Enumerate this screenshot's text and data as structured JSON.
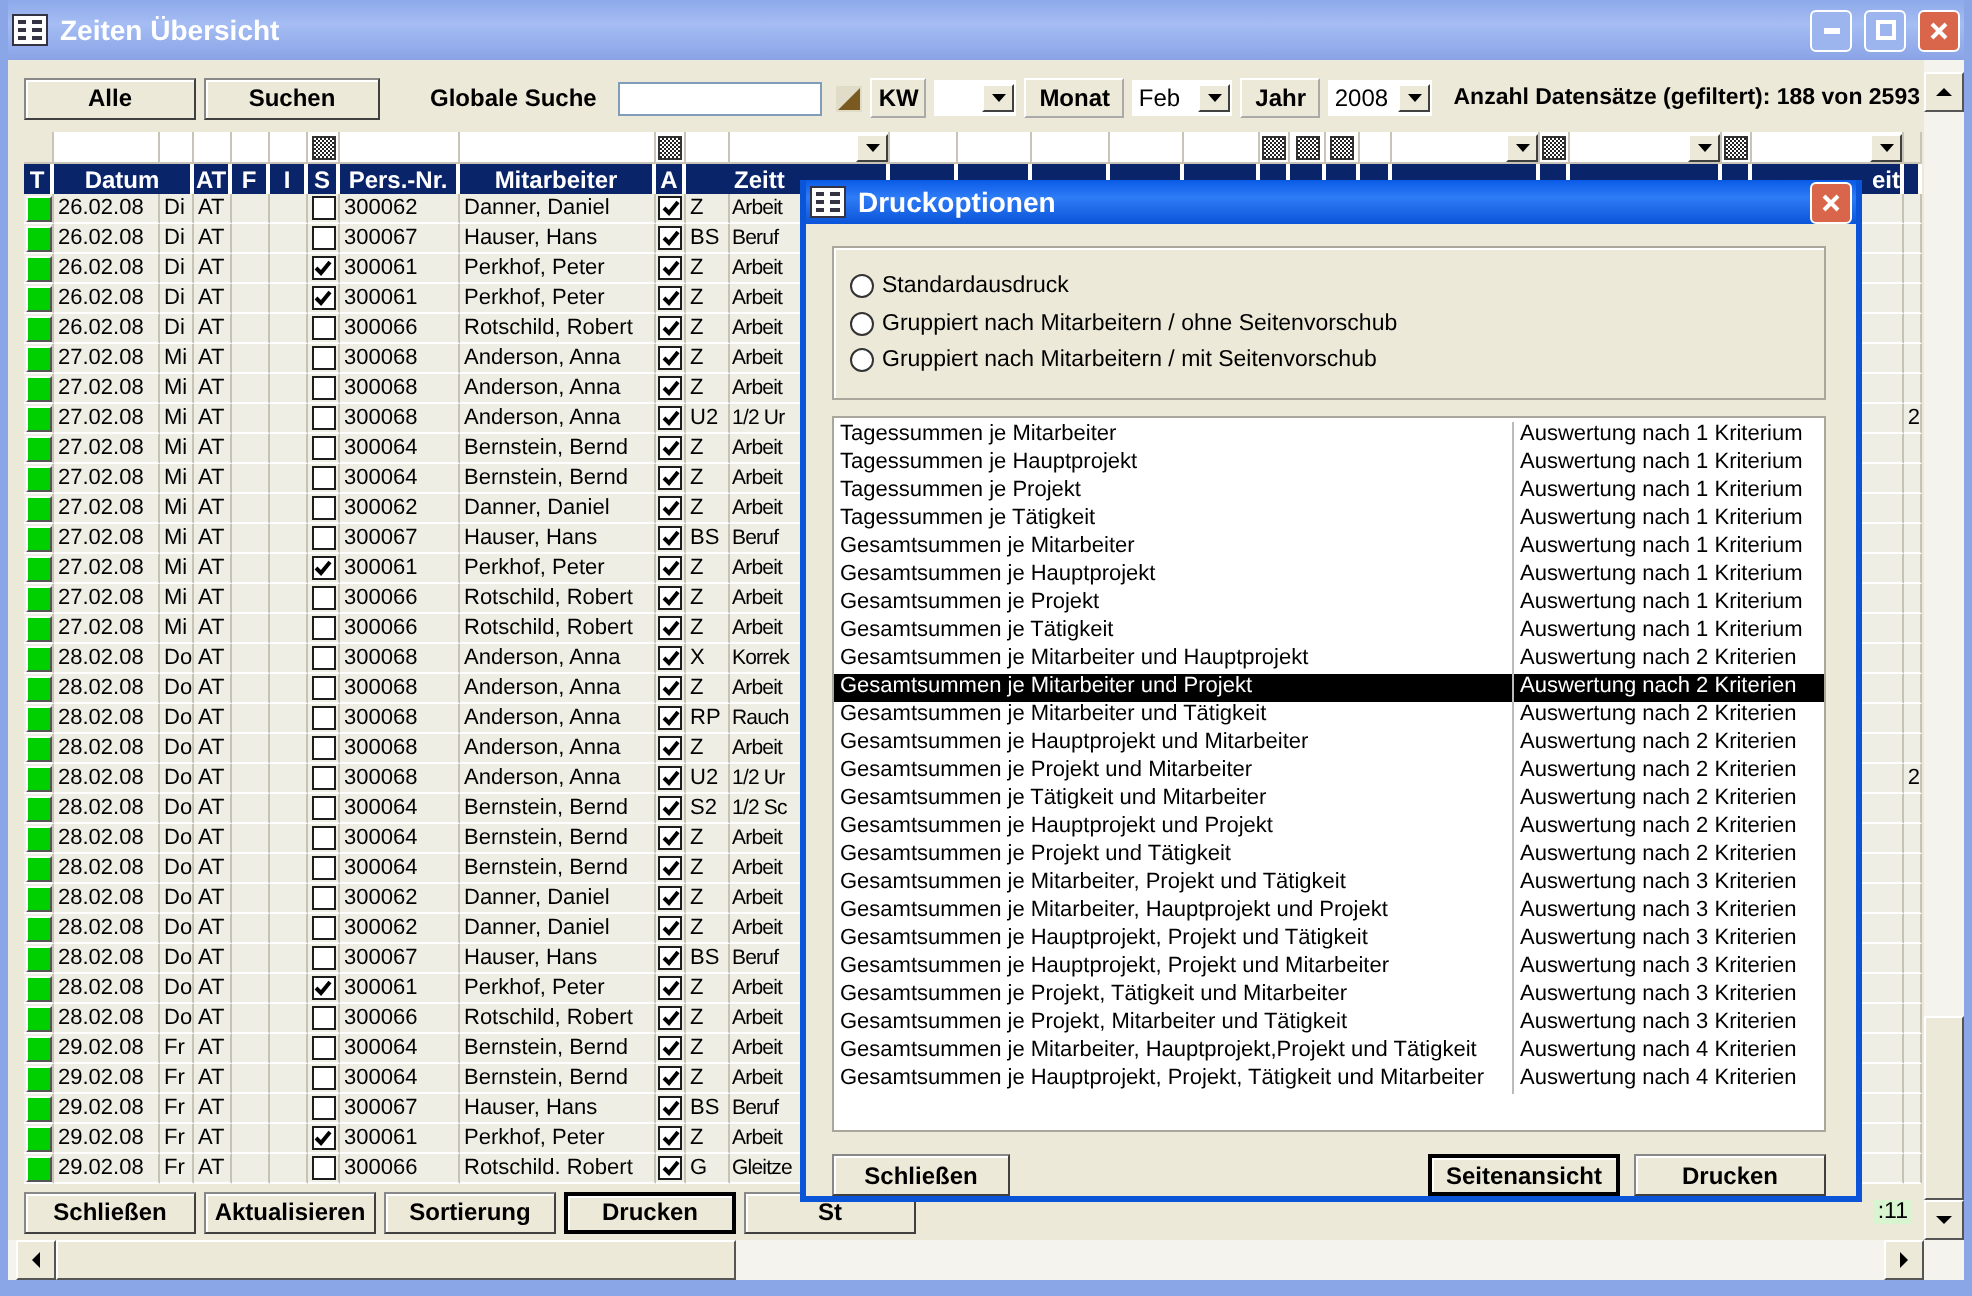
{
  "window": {
    "title": "Zeiten Übersicht"
  },
  "toolbar": {
    "buttons": [
      "Alle",
      "Suchen"
    ],
    "search_label": "Globale Suche",
    "kw_label": "KW",
    "month_label": "Monat",
    "month_value": "Feb",
    "year_label": "Jahr",
    "year_value": "2008",
    "record_count": "Anzahl Datensätze (gefiltert): 188 von 2593"
  },
  "grid": {
    "columns": [
      "T",
      "Datum",
      "AT",
      "F",
      "I",
      "S",
      "Pers.-Nr.",
      "Mitarbeiter",
      "A",
      "Zeitt"
    ],
    "last_column": "eit",
    "rows": [
      {
        "date": "26.02.08",
        "day": "Di",
        "at": "AT",
        "s": false,
        "pers": "300062",
        "name": "Danner, Daniel",
        "a": true,
        "code": "Z",
        "text": "Arbeit"
      },
      {
        "date": "26.02.08",
        "day": "Di",
        "at": "AT",
        "s": false,
        "pers": "300067",
        "name": "Hauser, Hans",
        "a": true,
        "code": "BS",
        "text": "Beruf"
      },
      {
        "date": "26.02.08",
        "day": "Di",
        "at": "AT",
        "s": true,
        "pers": "300061",
        "name": "Perkhof, Peter",
        "a": true,
        "code": "Z",
        "text": "Arbeit"
      },
      {
        "date": "26.02.08",
        "day": "Di",
        "at": "AT",
        "s": true,
        "pers": "300061",
        "name": "Perkhof, Peter",
        "a": true,
        "code": "Z",
        "text": "Arbeit"
      },
      {
        "date": "26.02.08",
        "day": "Di",
        "at": "AT",
        "s": false,
        "pers": "300066",
        "name": "Rotschild, Robert",
        "a": true,
        "code": "Z",
        "text": "Arbeit"
      },
      {
        "date": "27.02.08",
        "day": "Mi",
        "at": "AT",
        "s": false,
        "pers": "300068",
        "name": "Anderson, Anna",
        "a": true,
        "code": "Z",
        "text": "Arbeit"
      },
      {
        "date": "27.02.08",
        "day": "Mi",
        "at": "AT",
        "s": false,
        "pers": "300068",
        "name": "Anderson, Anna",
        "a": true,
        "code": "Z",
        "text": "Arbeit"
      },
      {
        "date": "27.02.08",
        "day": "Mi",
        "at": "AT",
        "s": false,
        "pers": "300068",
        "name": "Anderson, Anna",
        "a": true,
        "code": "U2",
        "text": "1/2 Ur",
        "last": "2"
      },
      {
        "date": "27.02.08",
        "day": "Mi",
        "at": "AT",
        "s": false,
        "pers": "300064",
        "name": "Bernstein, Bernd",
        "a": true,
        "code": "Z",
        "text": "Arbeit"
      },
      {
        "date": "27.02.08",
        "day": "Mi",
        "at": "AT",
        "s": false,
        "pers": "300064",
        "name": "Bernstein, Bernd",
        "a": true,
        "code": "Z",
        "text": "Arbeit"
      },
      {
        "date": "27.02.08",
        "day": "Mi",
        "at": "AT",
        "s": false,
        "pers": "300062",
        "name": "Danner, Daniel",
        "a": true,
        "code": "Z",
        "text": "Arbeit"
      },
      {
        "date": "27.02.08",
        "day": "Mi",
        "at": "AT",
        "s": false,
        "pers": "300067",
        "name": "Hauser, Hans",
        "a": true,
        "code": "BS",
        "text": "Beruf"
      },
      {
        "date": "27.02.08",
        "day": "Mi",
        "at": "AT",
        "s": true,
        "pers": "300061",
        "name": "Perkhof, Peter",
        "a": true,
        "code": "Z",
        "text": "Arbeit"
      },
      {
        "date": "27.02.08",
        "day": "Mi",
        "at": "AT",
        "s": false,
        "pers": "300066",
        "name": "Rotschild, Robert",
        "a": true,
        "code": "Z",
        "text": "Arbeit"
      },
      {
        "date": "27.02.08",
        "day": "Mi",
        "at": "AT",
        "s": false,
        "pers": "300066",
        "name": "Rotschild, Robert",
        "a": true,
        "code": "Z",
        "text": "Arbeit"
      },
      {
        "date": "28.02.08",
        "day": "Do",
        "at": "AT",
        "s": false,
        "pers": "300068",
        "name": "Anderson, Anna",
        "a": true,
        "code": "X",
        "text": "Korrek"
      },
      {
        "date": "28.02.08",
        "day": "Do",
        "at": "AT",
        "s": false,
        "pers": "300068",
        "name": "Anderson, Anna",
        "a": true,
        "code": "Z",
        "text": "Arbeit"
      },
      {
        "date": "28.02.08",
        "day": "Do",
        "at": "AT",
        "s": false,
        "pers": "300068",
        "name": "Anderson, Anna",
        "a": true,
        "code": "RP",
        "text": "Rauch"
      },
      {
        "date": "28.02.08",
        "day": "Do",
        "at": "AT",
        "s": false,
        "pers": "300068",
        "name": "Anderson, Anna",
        "a": true,
        "code": "Z",
        "text": "Arbeit"
      },
      {
        "date": "28.02.08",
        "day": "Do",
        "at": "AT",
        "s": false,
        "pers": "300068",
        "name": "Anderson, Anna",
        "a": true,
        "code": "U2",
        "text": "1/2 Ur",
        "last": "2"
      },
      {
        "date": "28.02.08",
        "day": "Do",
        "at": "AT",
        "s": false,
        "pers": "300064",
        "name": "Bernstein, Bernd",
        "a": true,
        "code": "S2",
        "text": "1/2 Sc"
      },
      {
        "date": "28.02.08",
        "day": "Do",
        "at": "AT",
        "s": false,
        "pers": "300064",
        "name": "Bernstein, Bernd",
        "a": true,
        "code": "Z",
        "text": "Arbeit"
      },
      {
        "date": "28.02.08",
        "day": "Do",
        "at": "AT",
        "s": false,
        "pers": "300064",
        "name": "Bernstein, Bernd",
        "a": true,
        "code": "Z",
        "text": "Arbeit"
      },
      {
        "date": "28.02.08",
        "day": "Do",
        "at": "AT",
        "s": false,
        "pers": "300062",
        "name": "Danner, Daniel",
        "a": true,
        "code": "Z",
        "text": "Arbeit"
      },
      {
        "date": "28.02.08",
        "day": "Do",
        "at": "AT",
        "s": false,
        "pers": "300062",
        "name": "Danner, Daniel",
        "a": true,
        "code": "Z",
        "text": "Arbeit"
      },
      {
        "date": "28.02.08",
        "day": "Do",
        "at": "AT",
        "s": false,
        "pers": "300067",
        "name": "Hauser, Hans",
        "a": true,
        "code": "BS",
        "text": "Beruf"
      },
      {
        "date": "28.02.08",
        "day": "Do",
        "at": "AT",
        "s": true,
        "pers": "300061",
        "name": "Perkhof, Peter",
        "a": true,
        "code": "Z",
        "text": "Arbeit"
      },
      {
        "date": "28.02.08",
        "day": "Do",
        "at": "AT",
        "s": false,
        "pers": "300066",
        "name": "Rotschild, Robert",
        "a": true,
        "code": "Z",
        "text": "Arbeit"
      },
      {
        "date": "29.02.08",
        "day": "Fr",
        "at": "AT",
        "s": false,
        "pers": "300064",
        "name": "Bernstein, Bernd",
        "a": true,
        "code": "Z",
        "text": "Arbeit"
      },
      {
        "date": "29.02.08",
        "day": "Fr",
        "at": "AT",
        "s": false,
        "pers": "300064",
        "name": "Bernstein, Bernd",
        "a": true,
        "code": "Z",
        "text": "Arbeit"
      },
      {
        "date": "29.02.08",
        "day": "Fr",
        "at": "AT",
        "s": false,
        "pers": "300067",
        "name": "Hauser, Hans",
        "a": true,
        "code": "BS",
        "text": "Beruf"
      },
      {
        "date": "29.02.08",
        "day": "Fr",
        "at": "AT",
        "s": true,
        "pers": "300061",
        "name": "Perkhof, Peter",
        "a": true,
        "code": "Z",
        "text": "Arbeit"
      },
      {
        "date": "29.02.08",
        "day": "Fr",
        "at": "AT",
        "s": false,
        "pers": "300066",
        "name": "Rotschild. Robert",
        "a": true,
        "code": "G",
        "text": "Gleitze"
      }
    ]
  },
  "bottom_buttons": [
    {
      "label": "Schließen",
      "default": false
    },
    {
      "label": "Aktualisieren",
      "default": false
    },
    {
      "label": "Sortierung",
      "default": false
    },
    {
      "label": "Drucken",
      "default": true
    },
    {
      "label": "St",
      "default": false
    }
  ],
  "status_cell": ":11",
  "dialog": {
    "title": "Druckoptionen",
    "options": [
      {
        "label": "Standardausdruck",
        "selected": false
      },
      {
        "label": "Gruppiert nach Mitarbeitern / ohne Seitenvorschub",
        "selected": false
      },
      {
        "label": "Gruppiert nach Mitarbeitern / mit Seitenvorschub",
        "selected": false
      }
    ],
    "reports": [
      {
        "name": "Tagessummen je Mitarbeiter",
        "type": "Auswertung nach 1 Kriterium",
        "selected": false
      },
      {
        "name": "Tagessummen je Hauptprojekt",
        "type": "Auswertung nach 1 Kriterium",
        "selected": false
      },
      {
        "name": "Tagessummen je Projekt",
        "type": "Auswertung nach 1 Kriterium",
        "selected": false
      },
      {
        "name": "Tagessummen je Tätigkeit",
        "type": "Auswertung nach 1 Kriterium",
        "selected": false
      },
      {
        "name": "Gesamtsummen je Mitarbeiter",
        "type": "Auswertung nach 1 Kriterium",
        "selected": false
      },
      {
        "name": "Gesamtsummen je Hauptprojekt",
        "type": "Auswertung nach 1 Kriterium",
        "selected": false
      },
      {
        "name": "Gesamtsummen je Projekt",
        "type": "Auswertung nach 1 Kriterium",
        "selected": false
      },
      {
        "name": "Gesamtsummen je Tätigkeit",
        "type": "Auswertung nach 1 Kriterium",
        "selected": false
      },
      {
        "name": "Gesamtsummen je Mitarbeiter und Hauptprojekt",
        "type": "Auswertung nach 2 Kriterien",
        "selected": false
      },
      {
        "name": "Gesamtsummen je Mitarbeiter und Projekt",
        "type": "Auswertung nach 2 Kriterien",
        "selected": true
      },
      {
        "name": "Gesamtsummen je Mitarbeiter und Tätigkeit",
        "type": "Auswertung nach 2 Kriterien",
        "selected": false
      },
      {
        "name": "Gesamtsummen je Hauptprojekt und Mitarbeiter",
        "type": "Auswertung nach 2 Kriterien",
        "selected": false
      },
      {
        "name": "Gesamtsummen je Projekt und Mitarbeiter",
        "type": "Auswertung nach 2 Kriterien",
        "selected": false
      },
      {
        "name": "Gesamtsummen je Tätigkeit und Mitarbeiter",
        "type": "Auswertung nach 2 Kriterien",
        "selected": false
      },
      {
        "name": "Gesamtsummen je Hauptprojekt und Projekt",
        "type": "Auswertung nach 2 Kriterien",
        "selected": false
      },
      {
        "name": "Gesamtsummen je Projekt und Tätigkeit",
        "type": "Auswertung nach 2 Kriterien",
        "selected": false
      },
      {
        "name": "Gesamtsummen je Mitarbeiter, Projekt und Tätigkeit",
        "type": "Auswertung nach 3 Kriterien",
        "selected": false
      },
      {
        "name": "Gesamtsummen je Mitarbeiter, Hauptprojekt und Projekt",
        "type": "Auswertung nach 3 Kriterien",
        "selected": false
      },
      {
        "name": "Gesamtsummen je Hauptprojekt, Projekt und Tätigkeit",
        "type": "Auswertung nach 3 Kriterien",
        "selected": false
      },
      {
        "name": "Gesamtsummen je Hauptprojekt, Projekt und Mitarbeiter",
        "type": "Auswertung nach 3 Kriterien",
        "selected": false
      },
      {
        "name": "Gesamtsummen je Projekt, Tätigkeit und Mitarbeiter",
        "type": "Auswertung nach 3 Kriterien",
        "selected": false
      },
      {
        "name": "Gesamtsummen je Projekt, Mitarbeiter und Tätigkeit",
        "type": "Auswertung nach 3 Kriterien",
        "selected": false
      },
      {
        "name": "Gesamtsummen je Mitarbeiter, Hauptprojekt,Projekt und Tätigkeit",
        "type": "Auswertung nach 4 Kriterien",
        "selected": false
      },
      {
        "name": "Gesamtsummen je Hauptprojekt, Projekt, Tätigkeit und Mitarbeiter",
        "type": "Auswertung nach 4 Kriterien",
        "selected": false
      }
    ],
    "buttons_left": [
      {
        "label": "Schließen",
        "default": false
      }
    ],
    "buttons_right": [
      {
        "label": "Seitenansicht",
        "default": true
      },
      {
        "label": "Drucken",
        "default": false
      }
    ]
  }
}
